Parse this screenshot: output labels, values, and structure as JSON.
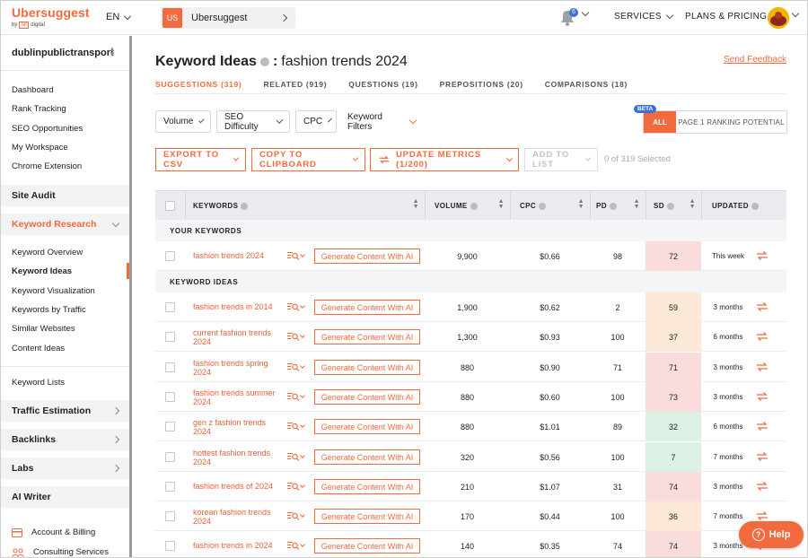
{
  "topbar": {
    "logo": "Ubersuggest",
    "logo_by": "by",
    "logo_np": "NP",
    "logo_digital": "digital",
    "language": "EN",
    "project_badge": "US",
    "project_name": "Ubersuggest",
    "notifications": "6",
    "services": "SERVICES",
    "plans": "PLANS & PRICING"
  },
  "sidebar": {
    "domain": "dublinpublictransport",
    "links": [
      "Dashboard",
      "Rank Tracking",
      "SEO Opportunities",
      "My Workspace",
      "Chrome Extension"
    ],
    "site_audit": "Site Audit",
    "keyword_research": "Keyword Research",
    "kr_items": [
      "Keyword Overview",
      "Keyword Ideas",
      "Keyword Visualization",
      "Keywords by Traffic",
      "Similar Websites",
      "Content Ideas"
    ],
    "keyword_lists": "Keyword Lists",
    "traffic_estimation": "Traffic Estimation",
    "backlinks": "Backlinks",
    "labs": "Labs",
    "ai_writer": "AI Writer",
    "account_billing": "Account & Billing",
    "consulting": "Consulting Services"
  },
  "main": {
    "title": "Keyword Ideas",
    "title_sep": ":",
    "query": "fashion trends 2024",
    "feedback": "Send Feedback",
    "tabs": [
      "SUGGESTIONS (319)",
      "RELATED (919)",
      "QUESTIONS (19)",
      "PREPOSITIONS (20)",
      "COMPARISONS (18)"
    ],
    "filters": [
      "Volume",
      "SEO Difficulty",
      "CPC",
      "Keyword Filters"
    ],
    "beta": "BETA",
    "seg_all": "ALL",
    "seg_page1": "PAGE 1 RANKING POTENTIAL",
    "export": "EXPORT TO CSV",
    "copy": "COPY TO CLIPBOARD",
    "update": "UPDATE METRICS (1/200)",
    "add_list": "ADD TO LIST",
    "selected": "0 of 319 Selected"
  },
  "table": {
    "headers": {
      "keywords": "KEYWORDS",
      "volume": "VOLUME",
      "cpc": "CPC",
      "pd": "PD",
      "sd": "SD",
      "updated": "UPDATED"
    },
    "your_keywords": "YOUR KEYWORDS",
    "keyword_ideas": "KEYWORD IDEAS",
    "generate_label": "Generate Content With AI",
    "your_row": {
      "keyword": "fashion trends 2024",
      "volume": "9,900",
      "cpc": "$0.66",
      "pd": "98",
      "sd": "72",
      "updated": "This week",
      "sd_color": "#fadcdc"
    },
    "rows": [
      {
        "keyword": "fashion trends in 2014",
        "volume": "1,900",
        "cpc": "$0.62",
        "pd": "2",
        "sd": "59",
        "updated": "3 months",
        "sd_color": "#fbe8d6"
      },
      {
        "keyword": "current fashion trends 2024",
        "volume": "1,300",
        "cpc": "$0.93",
        "pd": "100",
        "sd": "37",
        "updated": "6 months",
        "sd_color": "#fbe8d6"
      },
      {
        "keyword": "fashion trends spring 2024",
        "volume": "880",
        "cpc": "$0.90",
        "pd": "71",
        "sd": "71",
        "updated": "3 months",
        "sd_color": "#fadcdc"
      },
      {
        "keyword": "fashion trends summer 2024",
        "volume": "880",
        "cpc": "$0.60",
        "pd": "100",
        "sd": "73",
        "updated": "3 months",
        "sd_color": "#fadcdc"
      },
      {
        "keyword": "gen z fashion trends 2024",
        "volume": "880",
        "cpc": "$1.01",
        "pd": "89",
        "sd": "32",
        "updated": "6 months",
        "sd_color": "#dcf1e4"
      },
      {
        "keyword": "hottest fashion trends 2024",
        "volume": "320",
        "cpc": "$0.56",
        "pd": "100",
        "sd": "7",
        "updated": "7 months",
        "sd_color": "#dcf1e4"
      },
      {
        "keyword": "fashion trends of 2024",
        "volume": "210",
        "cpc": "$1.07",
        "pd": "31",
        "sd": "74",
        "updated": "3 months",
        "sd_color": "#fadcdc"
      },
      {
        "keyword": "korean fashion trends 2024",
        "volume": "170",
        "cpc": "$0.44",
        "pd": "100",
        "sd": "36",
        "updated": "7 months",
        "sd_color": "#fbe8d6"
      },
      {
        "keyword": "fashion trends in 2024",
        "volume": "140",
        "cpc": "$0.35",
        "pd": "74",
        "sd": "74",
        "updated": "3 months",
        "sd_color": "#fadcdc"
      }
    ]
  },
  "help": "Help",
  "colors": {
    "accent": "#f26a3d",
    "beta": "#3b6fe0"
  }
}
